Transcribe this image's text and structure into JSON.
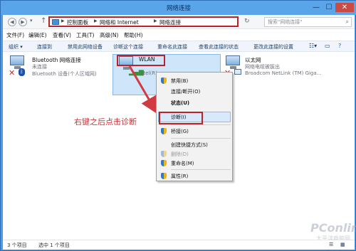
{
  "window": {
    "title": "网络连接",
    "minimize": "—",
    "maximize": "☐",
    "close": "✕"
  },
  "address": {
    "crumbs": [
      "控制面板",
      "网络和 Internet",
      "网络连接"
    ],
    "search_placeholder": "搜索\"网络连接\""
  },
  "menubar": {
    "items": [
      "文件(F)",
      "编辑(E)",
      "查看(V)",
      "工具(T)",
      "高级(N)",
      "帮助(H)"
    ]
  },
  "toolbar": {
    "items": [
      "组织 ▾",
      "连接到",
      "禁用此网络设备",
      "诊断这个连接",
      "重命名此连接",
      "查看此连接的状态",
      "更改此连接的设置"
    ]
  },
  "adapters": [
    {
      "name": "Bluetooth 网络连接",
      "status": "未连接",
      "device": "Bluetooth 设备(个人区域网)"
    },
    {
      "name": "WLAN",
      "status": "",
      "device": "Intel(R)"
    },
    {
      "name": "以太网",
      "status": "网络电缆被拔出",
      "device": "Broadcom NetLink (TM) Giga..."
    }
  ],
  "context_menu": {
    "items": [
      {
        "label": "禁用(B)",
        "icon": "shield-icon"
      },
      {
        "label": "连接/断开(O)",
        "icon": ""
      },
      {
        "label": "状态(U)",
        "icon": ""
      },
      {
        "label": "诊断(I)",
        "icon": ""
      },
      {
        "label": "桥接(G)",
        "icon": "shield-icon"
      },
      {
        "label": "创建快捷方式(S)",
        "icon": ""
      },
      {
        "label": "删除(D)",
        "icon": "shield-icon"
      },
      {
        "label": "重命名(M)",
        "icon": "shield-icon"
      },
      {
        "label": "属性(R)",
        "icon": "shield-icon"
      }
    ]
  },
  "annotation": "右键之后点击诊断",
  "status": {
    "count": "3 个项目",
    "selected": "选中 1 个项目"
  },
  "watermark": {
    "brand": "PConline",
    "sub": "太平洋电脑网"
  },
  "colors": {
    "highlight_box": "#b8242b",
    "selection": "#cfe6fa",
    "title_bar": "#5aa5ea"
  }
}
